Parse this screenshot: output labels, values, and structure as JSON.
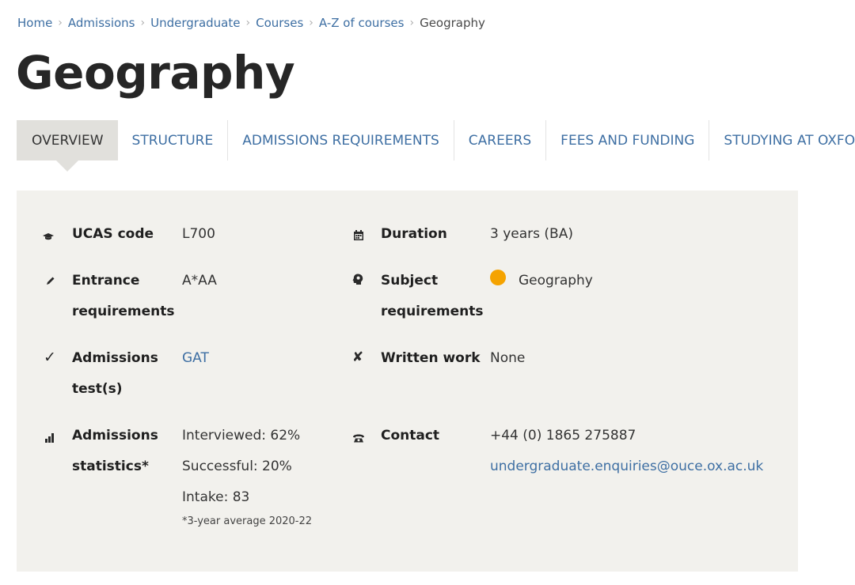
{
  "breadcrumb": {
    "items": [
      "Home",
      "Admissions",
      "Undergraduate",
      "Courses",
      "A-Z of courses"
    ],
    "current": "Geography",
    "separator": "›"
  },
  "page_title": "Geography",
  "tabs": [
    "OVERVIEW",
    "STRUCTURE",
    "ADMISSIONS REQUIREMENTS",
    "CAREERS",
    "FEES AND FUNDING",
    "STUDYING AT OXFORD"
  ],
  "active_tab": "OVERVIEW",
  "facts": {
    "ucas": {
      "icon": "graduation-cap-icon",
      "label": "UCAS code",
      "value": "L700"
    },
    "entrance": {
      "icon": "pencil-icon",
      "label_line1": "Entrance",
      "label_line2": "requirements",
      "value": "A*AA"
    },
    "tests": {
      "icon": "checkmark-icon",
      "label_line1": "Admissions",
      "label_line2": "test(s)",
      "value": "GAT"
    },
    "stats": {
      "icon": "bar-chart-icon",
      "label_line1": "Admissions",
      "label_line2": "statistics*",
      "interviewed": "Interviewed: 62%",
      "successful": "Successful: 20%",
      "intake": "Intake: 83",
      "note": "*3-year average 2020-22"
    },
    "duration": {
      "icon": "calendar-icon",
      "label": "Duration",
      "value": "3 years (BA)"
    },
    "subject": {
      "icon": "head-icon",
      "label_line1": "Subject",
      "label_line2": "requirements",
      "value": "Geography",
      "dot_color": "#f5a300"
    },
    "written": {
      "icon": "cross-icon",
      "label": "Written work",
      "value": "None"
    },
    "contact": {
      "icon": "telephone-icon",
      "label": "Contact",
      "phone": "+44 (0) 1865 275887",
      "email": "undergraduate.enquiries@ouce.ox.ac.uk"
    }
  },
  "colors": {
    "link": "#3e6fa3",
    "panel_bg": "#f2f1ed",
    "active_tab_bg": "#e1e0dc",
    "dot": "#f5a300"
  }
}
